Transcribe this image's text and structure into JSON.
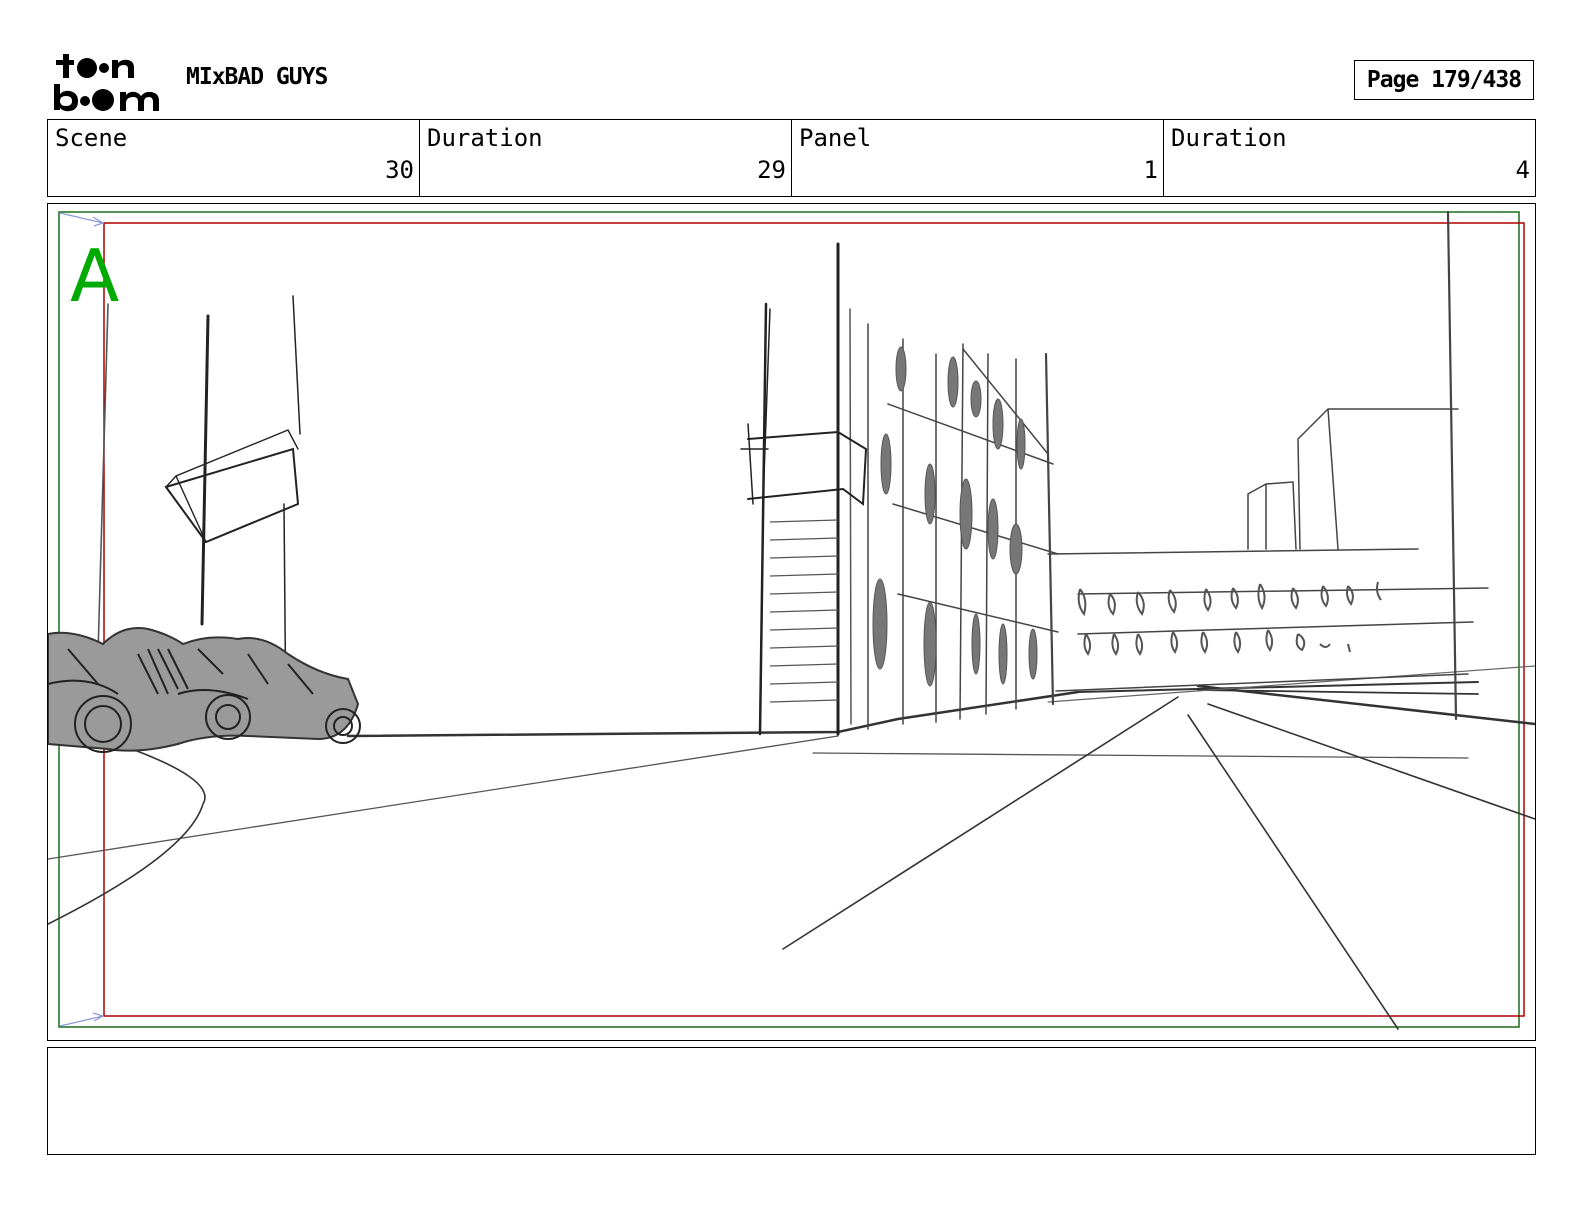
{
  "header": {
    "logo_icon": "toon-boom-logo",
    "project_title": "MIxBAD GUYS",
    "page_label": "Page 179/438"
  },
  "info": {
    "scene_label": "Scene",
    "scene_value": "30",
    "scene_duration_label": "Duration",
    "scene_duration_value": "29",
    "panel_label": "Panel",
    "panel_value": "1",
    "panel_duration_label": "Duration",
    "panel_duration_value": "4"
  },
  "panel": {
    "layer_marker": "A",
    "marker_color": "#00aa00",
    "safe_frame_color": "#b00000",
    "camera_frame_color": "#1a6b1a"
  },
  "caption": {
    "text": ""
  }
}
